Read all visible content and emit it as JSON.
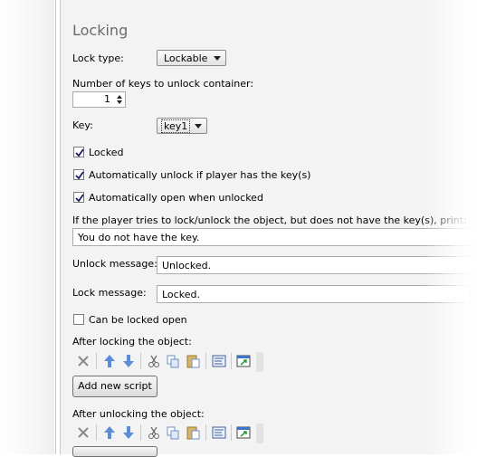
{
  "section": {
    "title": "Locking"
  },
  "lock_type": {
    "label": "Lock type:",
    "value": "Lockable"
  },
  "num_keys": {
    "label": "Number of keys to unlock container:",
    "value": "1"
  },
  "key": {
    "label": "Key:",
    "value": "key1"
  },
  "checkboxes": {
    "locked": {
      "label": "Locked",
      "checked": true
    },
    "auto_unlock": {
      "label": "Automatically unlock if player has the key(s)",
      "checked": true
    },
    "auto_open": {
      "label": "Automatically open when unlocked",
      "checked": true
    },
    "can_be_locked_open": {
      "label": "Can be locked open",
      "checked": false
    }
  },
  "no_key_message": {
    "label": "If the player tries to lock/unlock the object, but does not have the key(s), print:",
    "value": "You do not have the key."
  },
  "unlock_message": {
    "label": "Unlock message:",
    "value": "Unlocked."
  },
  "lock_message": {
    "label": "Lock message:",
    "value": "Locked."
  },
  "after_locking": {
    "label": "After locking the object:",
    "add_script_label": "Add new script"
  },
  "after_unlocking": {
    "label": "After unlocking the object:"
  },
  "toolbar_icons": [
    "delete-icon",
    "move-up-icon",
    "move-down-icon",
    "cut-icon",
    "copy-icon",
    "paste-icon",
    "code-view-icon",
    "popout-icon"
  ],
  "colors": {
    "accent_blue": "#3a73c9",
    "heading_gray": "#6b6b6b",
    "panel_bg": "#f3f3f3"
  }
}
